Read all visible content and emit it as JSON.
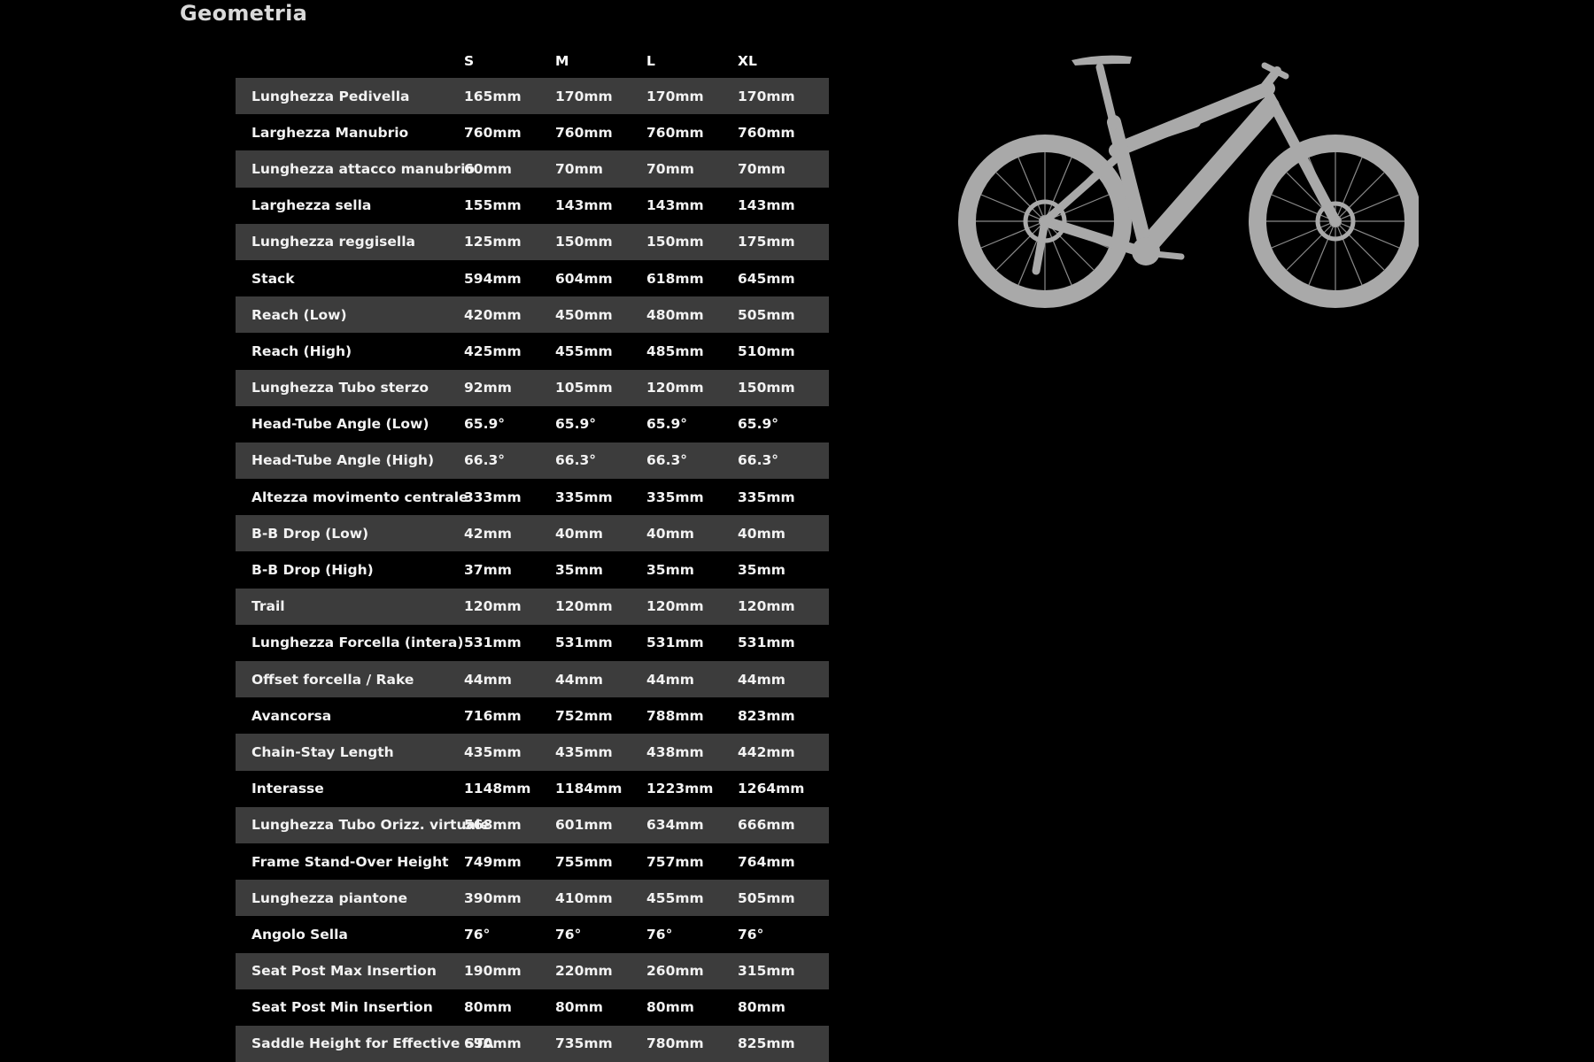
{
  "page": {
    "title": "Geometria"
  },
  "table": {
    "sizes": [
      "S",
      "M",
      "L",
      "XL"
    ],
    "rows": [
      {
        "label": "Lunghezza Pedivella",
        "values": [
          "165mm",
          "170mm",
          "170mm",
          "170mm"
        ]
      },
      {
        "label": "Larghezza Manubrio",
        "values": [
          "760mm",
          "760mm",
          "760mm",
          "760mm"
        ]
      },
      {
        "label": "Lunghezza attacco manubrio",
        "values": [
          "60mm",
          "70mm",
          "70mm",
          "70mm"
        ]
      },
      {
        "label": "Larghezza sella",
        "values": [
          "155mm",
          "143mm",
          "143mm",
          "143mm"
        ]
      },
      {
        "label": "Lunghezza reggisella",
        "values": [
          "125mm",
          "150mm",
          "150mm",
          "175mm"
        ]
      },
      {
        "label": "Stack",
        "values": [
          "594mm",
          "604mm",
          "618mm",
          "645mm"
        ]
      },
      {
        "label": "Reach (Low)",
        "values": [
          "420mm",
          "450mm",
          "480mm",
          "505mm"
        ]
      },
      {
        "label": "Reach (High)",
        "values": [
          "425mm",
          "455mm",
          "485mm",
          "510mm"
        ]
      },
      {
        "label": "Lunghezza Tubo sterzo",
        "values": [
          "92mm",
          "105mm",
          "120mm",
          "150mm"
        ]
      },
      {
        "label": "Head-Tube Angle (Low)",
        "values": [
          "65.9°",
          "65.9°",
          "65.9°",
          "65.9°"
        ]
      },
      {
        "label": "Head-Tube Angle (High)",
        "values": [
          "66.3°",
          "66.3°",
          "66.3°",
          "66.3°"
        ]
      },
      {
        "label": "Altezza movimento centrale",
        "values": [
          "333mm",
          "335mm",
          "335mm",
          "335mm"
        ]
      },
      {
        "label": "B-B Drop (Low)",
        "values": [
          "42mm",
          "40mm",
          "40mm",
          "40mm"
        ]
      },
      {
        "label": "B-B Drop (High)",
        "values": [
          "37mm",
          "35mm",
          "35mm",
          "35mm"
        ]
      },
      {
        "label": "Trail",
        "values": [
          "120mm",
          "120mm",
          "120mm",
          "120mm"
        ]
      },
      {
        "label": "Lunghezza Forcella (intera)",
        "values": [
          "531mm",
          "531mm",
          "531mm",
          "531mm"
        ]
      },
      {
        "label": "Offset forcella / Rake",
        "values": [
          "44mm",
          "44mm",
          "44mm",
          "44mm"
        ]
      },
      {
        "label": "Avancorsa",
        "values": [
          "716mm",
          "752mm",
          "788mm",
          "823mm"
        ]
      },
      {
        "label": "Chain-Stay Length",
        "values": [
          "435mm",
          "435mm",
          "438mm",
          "442mm"
        ]
      },
      {
        "label": "Interasse",
        "values": [
          "1148mm",
          "1184mm",
          "1223mm",
          "1264mm"
        ]
      },
      {
        "label": "Lunghezza Tubo Orizz. virtuale",
        "values": [
          "568mm",
          "601mm",
          "634mm",
          "666mm"
        ]
      },
      {
        "label": "Frame Stand-Over Height",
        "values": [
          "749mm",
          "755mm",
          "757mm",
          "764mm"
        ]
      },
      {
        "label": "Lunghezza piantone",
        "values": [
          "390mm",
          "410mm",
          "455mm",
          "505mm"
        ]
      },
      {
        "label": "Angolo Sella",
        "values": [
          "76°",
          "76°",
          "76°",
          "76°"
        ]
      },
      {
        "label": "Seat Post Max Insertion",
        "values": [
          "190mm",
          "220mm",
          "260mm",
          "315mm"
        ]
      },
      {
        "label": "Seat Post Min Insertion",
        "values": [
          "80mm",
          "80mm",
          "80mm",
          "80mm"
        ]
      },
      {
        "label": "Saddle Height for Effective STA",
        "values": [
          "690mm",
          "735mm",
          "780mm",
          "825mm"
        ]
      }
    ]
  },
  "image": {
    "icon": "mountain-bike-silhouette",
    "color": "#a9a9a9"
  },
  "colors": {
    "background": "#000000",
    "row_odd": "#3c3c3c",
    "row_even": "#000000",
    "text": "#f2f2f2",
    "title": "#d9d9d9"
  }
}
